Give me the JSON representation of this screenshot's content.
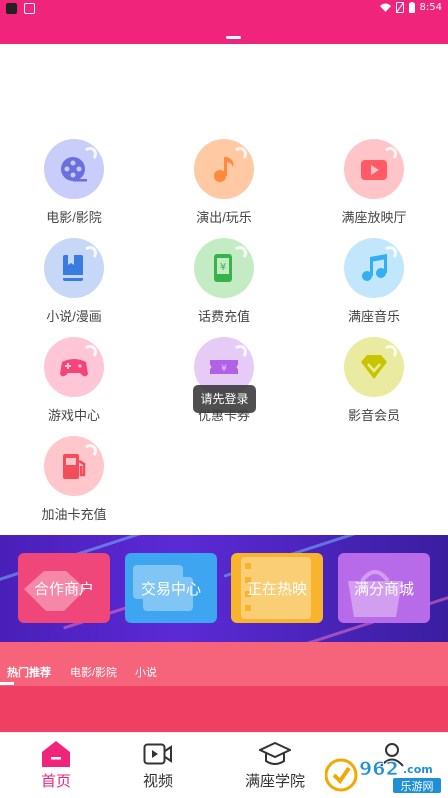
{
  "status_bar": {
    "time": "8:54"
  },
  "categories": [
    {
      "label": "电影/影院",
      "icon": "film-reel-icon",
      "color": "#c9cdfa",
      "glyph": "#6b6fe0"
    },
    {
      "label": "演出/玩乐",
      "icon": "music-note-icon",
      "color": "#ffc9a4",
      "glyph": "#ff8a3d"
    },
    {
      "label": "满座放映厅",
      "icon": "video-camera-icon",
      "color": "#ffc4c8",
      "glyph": "#ff5a66"
    },
    {
      "label": "小说/漫画",
      "icon": "book-icon",
      "color": "#c7d7f7",
      "glyph": "#3a7be0"
    },
    {
      "label": "话费充值",
      "icon": "phone-yuan-icon",
      "color": "#c4ecc4",
      "glyph": "#38b24a"
    },
    {
      "label": "满座音乐",
      "icon": "music-notes-icon",
      "color": "#c2e6fb",
      "glyph": "#33aef0"
    },
    {
      "label": "游戏中心",
      "icon": "gamepad-icon",
      "color": "#ffc6d8",
      "glyph": "#f4457a"
    },
    {
      "label": "优惠卡券",
      "icon": "coupon-icon",
      "color": "#e7cbf7",
      "glyph": "#b160e8"
    },
    {
      "label": "影音会员",
      "icon": "diamond-icon",
      "color": "#eaeaa0",
      "glyph": "#c8c400"
    },
    {
      "label": "加油卡充值",
      "icon": "fuel-pump-icon",
      "color": "#ffc6cc",
      "glyph": "#f24d5b"
    }
  ],
  "toast": {
    "text": "请先登录"
  },
  "banner_tiles": [
    {
      "label": "合作商户",
      "color": "#f0477a"
    },
    {
      "label": "交易中心",
      "color": "#3ea6f0"
    },
    {
      "label": "正在热映",
      "color": "#f7b42c"
    },
    {
      "label": "满分商城",
      "color": "#b86be8"
    }
  ],
  "content_tabs": [
    {
      "label": "热门推荐"
    },
    {
      "label": "电影/影院"
    },
    {
      "label": "小说"
    }
  ],
  "bottom_nav": [
    {
      "label": "首页",
      "icon": "home-icon"
    },
    {
      "label": "视频",
      "icon": "video-icon"
    },
    {
      "label": "满座学院",
      "icon": "graduation-cap-icon"
    },
    {
      "label": "",
      "icon": "profile-icon"
    }
  ],
  "watermark": {
    "text": "962",
    "subtext": "乐游网"
  }
}
